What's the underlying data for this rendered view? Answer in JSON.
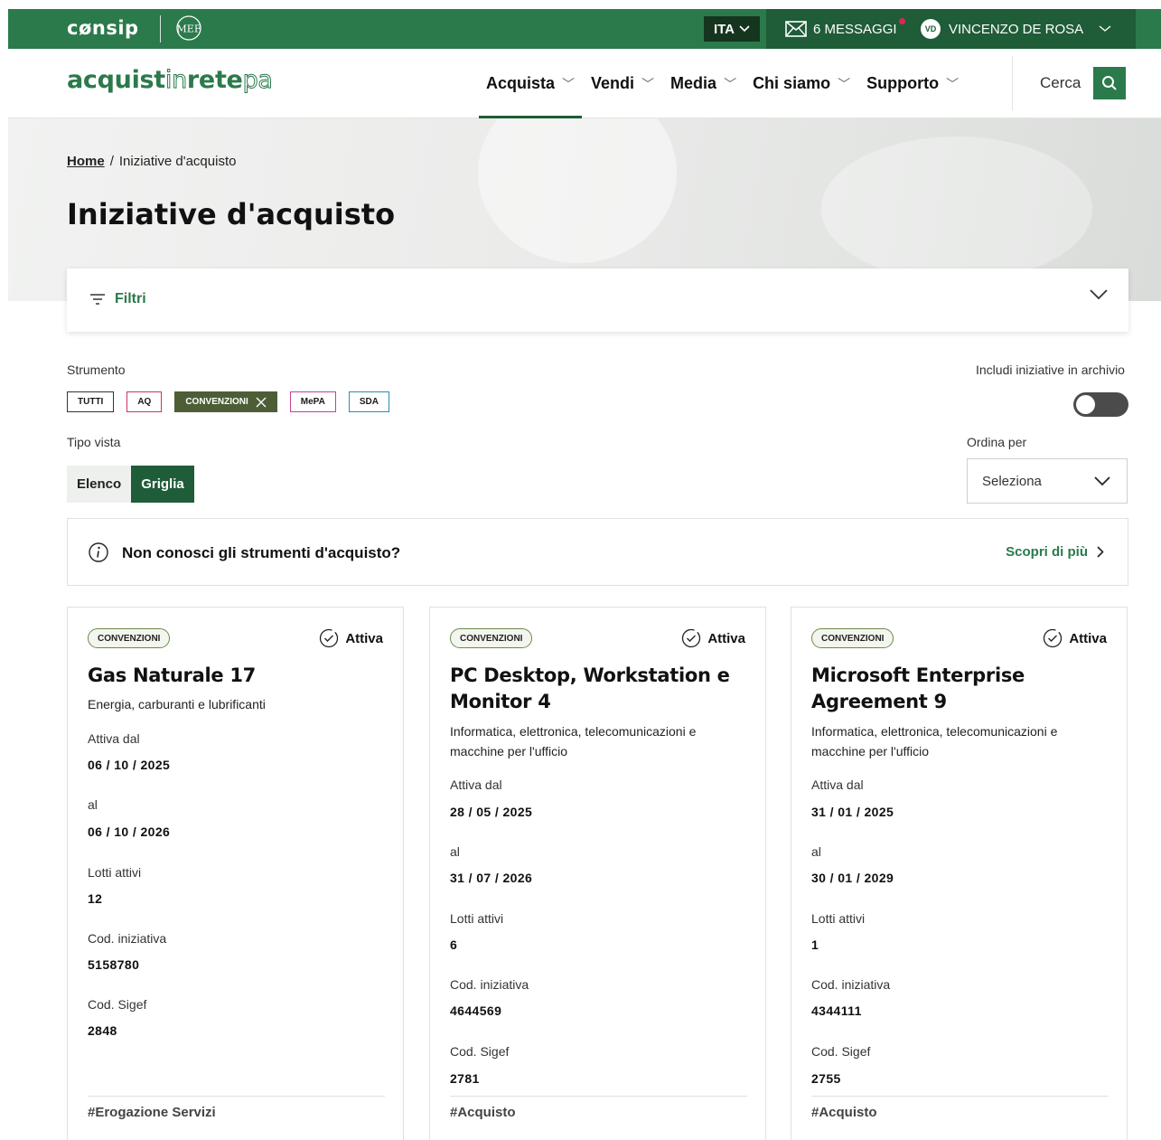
{
  "topbar": {
    "logo": "cønsip",
    "mef_logo": "MEF",
    "language": "ITA",
    "messages_label": "6 MESSAGGI",
    "user_initials": "VD",
    "user_name": "VINCENZO DE ROSA"
  },
  "nav": {
    "brand_part1": "acquist",
    "brand_part2": "in",
    "brand_part3": "rete",
    "brand_part4": "pa",
    "items": [
      {
        "label": "Acquista",
        "active": true
      },
      {
        "label": "Vendi",
        "active": false
      },
      {
        "label": "Media",
        "active": false
      },
      {
        "label": "Chi siamo",
        "active": false
      },
      {
        "label": "Supporto",
        "active": false
      }
    ],
    "search_label": "Cerca"
  },
  "breadcrumb": {
    "home": "Home",
    "separator": "/",
    "current": "Iniziative d'acquisto"
  },
  "page_title": "Iniziative d'acquisto",
  "filters": {
    "label": "Filtri",
    "strumento_label": "Strumento",
    "chips": [
      "TUTTI",
      "AQ",
      "CONVENZIONI",
      "MePA",
      "SDA"
    ],
    "active_chip": "CONVENZIONI",
    "archive_label": "Includi iniziative in archivio",
    "archive_enabled": false,
    "view_label": "Tipo vista",
    "view_options": [
      "Elenco",
      "Griglia"
    ],
    "view_selected": "Griglia",
    "sort_label": "Ordina per",
    "sort_value": "Seleziona"
  },
  "info_banner": {
    "text": "Non conosci gli strumenti d'acquisto?",
    "link": "Scopri di più"
  },
  "card_labels": {
    "active_from": "Attiva dal",
    "to": "al",
    "lots": "Lotti attivi",
    "code": "Cod. iniziativa",
    "sigef": "Cod. Sigef"
  },
  "cards": [
    {
      "type": "CONVENZIONI",
      "status": "Attiva",
      "title": "Gas Naturale 17",
      "category": "Energia, carburanti e lubrificanti",
      "active_from": "06 / 10 / 2025",
      "to": "06 / 10 / 2026",
      "lots": "12",
      "code": "5158780",
      "sigef": "2848",
      "tag": "#Erogazione Servizi"
    },
    {
      "type": "CONVENZIONI",
      "status": "Attiva",
      "title": "PC Desktop, Workstation e Monitor 4",
      "category": "Informatica, elettronica, telecomunicazioni e macchine per l'ufficio",
      "active_from": "28 / 05 / 2025",
      "to": "31 / 07 / 2026",
      "lots": "6",
      "code": "4644569",
      "sigef": "2781",
      "tag": "#Acquisto"
    },
    {
      "type": "CONVENZIONI",
      "status": "Attiva",
      "title": "Microsoft Enterprise Agreement 9",
      "category": "Informatica, elettronica, telecomunicazioni e macchine per l'ufficio",
      "active_from": "31 / 01 / 2025",
      "to": "30 / 01 / 2029",
      "lots": "1",
      "code": "4344111",
      "sigef": "2755",
      "tag": "#Acquisto"
    }
  ],
  "colors": {
    "brand_green": "#2b7a4b",
    "dark_green": "#1f5c38",
    "chip_active": "#4d5e36",
    "notification_dot": "#e0245e"
  },
  "icons": {
    "messages": "envelope-icon",
    "search": "search-icon",
    "filter": "filter-lines-icon",
    "info": "info-circle-icon",
    "status": "check-circle-icon",
    "chip_remove": "close-icon"
  }
}
